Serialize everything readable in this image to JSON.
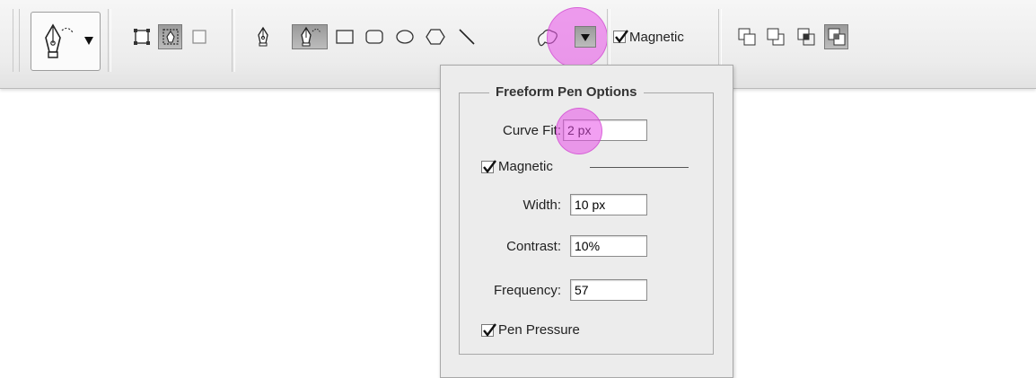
{
  "toolbar": {
    "magnetic_label": "Magnetic",
    "magnetic_checked": true,
    "groups": {
      "tool_preset": "pen-tool-preset",
      "path_modes": [
        "shape-layers-icon",
        "paths-icon",
        "fill-pixels-icon"
      ],
      "tools": [
        "pen-icon",
        "freeform-pen-icon",
        "rectangle-icon",
        "rounded-rectangle-icon",
        "ellipse-icon",
        "polygon-icon",
        "line-icon",
        "custom-shape-icon"
      ],
      "path_ops": [
        "add-to-area-icon",
        "subtract-from-area-icon",
        "intersect-areas-icon",
        "exclude-overlap-icon"
      ]
    }
  },
  "panel": {
    "title": "Freeform Pen Options",
    "curve_fit": {
      "label": "Curve Fit:",
      "value": "2 px"
    },
    "magnetic": {
      "label": "Magnetic",
      "checked": true
    },
    "width": {
      "label": "Width:",
      "value": "10 px"
    },
    "contrast": {
      "label": "Contrast:",
      "value": "10%"
    },
    "frequency": {
      "label": "Frequency:",
      "value": "57"
    },
    "pen_pressure": {
      "label": "Pen Pressure",
      "checked": true
    }
  },
  "colors": {
    "highlight": "#e850e8",
    "toolbar_bg": "#ececec",
    "panel_bg": "#ececec",
    "pressed_button": "#a8a8a8"
  }
}
